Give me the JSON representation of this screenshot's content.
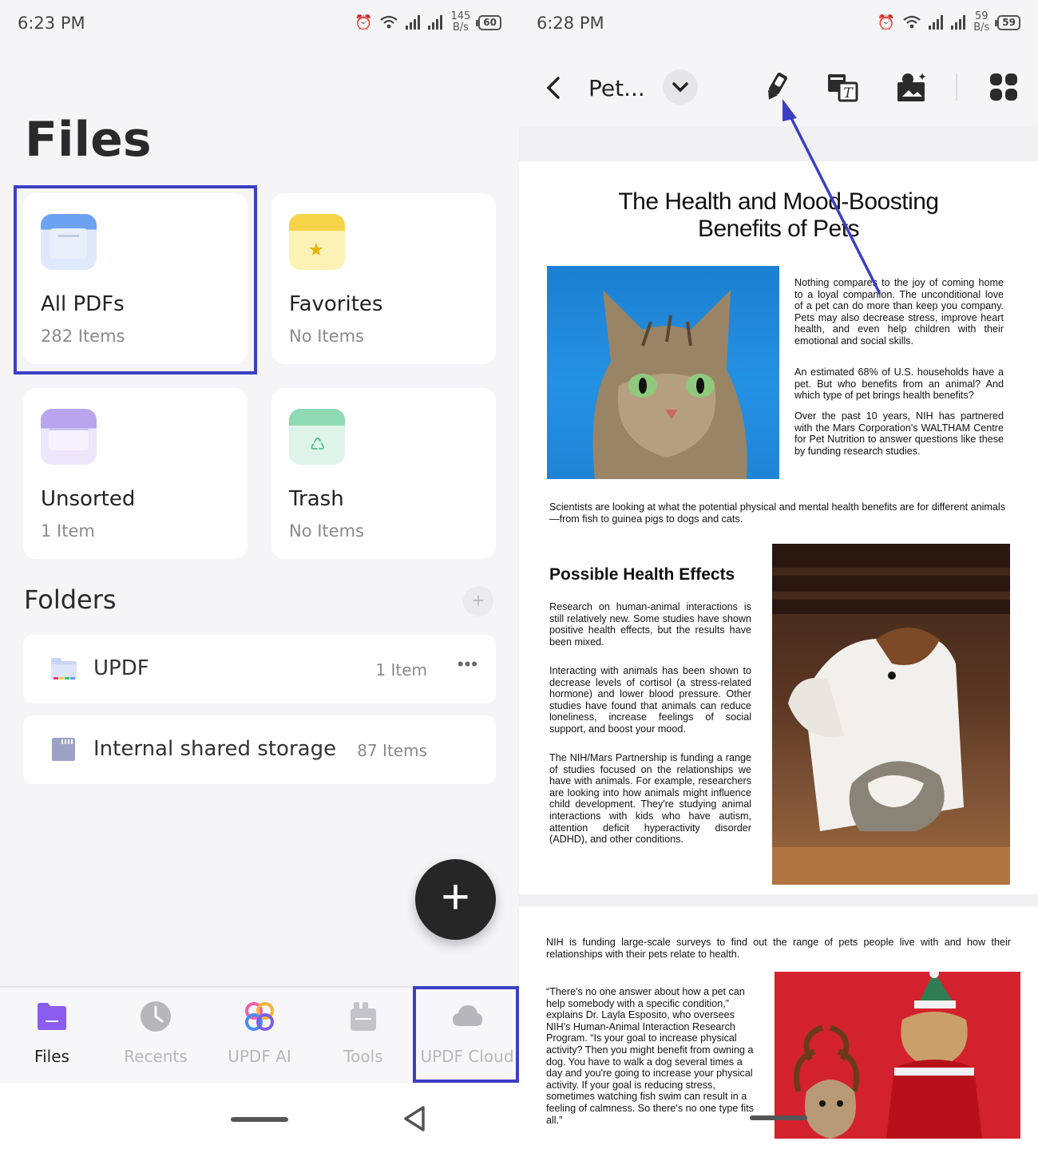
{
  "left": {
    "status": {
      "time": "6:23 PM",
      "speed_value": "145",
      "speed_unit": "B/s",
      "battery": "60"
    },
    "title": "Files",
    "categories": [
      {
        "name": "All PDFs",
        "count": "282 Items",
        "icon": "all-pdfs-icon"
      },
      {
        "name": "Favorites",
        "count": "No Items",
        "icon": "star-folder-icon"
      },
      {
        "name": "Unsorted",
        "count": "1 Item",
        "icon": "tray-icon"
      },
      {
        "name": "Trash",
        "count": "No Items",
        "icon": "recycle-bin-icon"
      }
    ],
    "folders_title": "Folders",
    "add_folder": "+",
    "folders": [
      {
        "name": "UPDF",
        "count": "1 Item",
        "more": "•••"
      },
      {
        "name": "Internal shared storage",
        "count": "87 Items"
      }
    ],
    "fab": "+",
    "tabs": [
      {
        "label": "Files",
        "icon": "files-icon",
        "active": true
      },
      {
        "label": "Recents",
        "icon": "clock-icon"
      },
      {
        "label": "UPDF AI",
        "icon": "ai-icon"
      },
      {
        "label": "Tools",
        "icon": "tools-icon"
      },
      {
        "label": "UPDF Cloud",
        "icon": "cloud-icon"
      }
    ],
    "colors": {
      "highlight": "#3b3fc4",
      "fab": "#262626"
    }
  },
  "right": {
    "status": {
      "time": "6:28 PM",
      "speed_value": "59",
      "speed_unit": "B/s",
      "battery": "59"
    },
    "toolbar": {
      "doc_name": "Pet...",
      "tools": [
        "pen-edit-icon",
        "text-edit-icon",
        "image-edit-icon",
        "grid-menu-icon"
      ]
    },
    "pdf": {
      "title_line1": "The Health and Mood-Boosting",
      "title_line2": "Benefits of Pets",
      "intro_p1": "Nothing compares to the joy of coming home to a loyal companion. The unconditional love of a pet can do more than keep you company. Pets may also decrease stress, improve heart health, and even help children with their emotional and social skills.",
      "intro_p2": "An estimated 68% of U.S. households have a pet. But who benefits from an animal? And which type of pet brings health benefits?",
      "intro_p3": "Over the past 10 years, NIH has partnered with the Mars Corporation's WALTHAM Centre for Pet Nutrition to answer questions like these by funding research studies.",
      "intro_p4": "Scientists are looking at what the potential physical and mental health benefits are for different animals—from fish to guinea pigs to dogs and cats.",
      "section_heading": "Possible Health Effects",
      "sec_p1": "Research on human-animal interactions is still relatively new. Some studies have shown positive health effects, but the results have been mixed.",
      "sec_p2": "Interacting with animals has been shown to decrease levels of cortisol (a stress-related hormone) and lower blood pressure. Other studies have found that animals can reduce loneliness, increase feelings of social support, and boost your mood.",
      "sec_p3": "The NIH/Mars Partnership is funding a range of studies focused on the relationships we have with animals. For example, researchers are looking into how animals might influence child development. They're studying animal interactions with kids who have autism, attention deficit hyperactivity disorder (ADHD), and other conditions.",
      "page2_p1": "NIH is funding large-scale surveys to find out the range of pets people live with and how their relationships with their pets relate to health.",
      "page2_quote": "“There's no one answer about how a pet can help somebody with a specific condition,” explains Dr. Layla Esposito, who oversees NIH's Human-Animal Interaction Research Program. “Is your goal to increase physical activity? Then you might benefit from owning a dog. You have to walk a dog several times a day and you're going to increase your physical activity. If your goal is reducing stress, sometimes watching fish swim can result in a feeling of calmness. So there's no one type fits all.”"
    }
  }
}
